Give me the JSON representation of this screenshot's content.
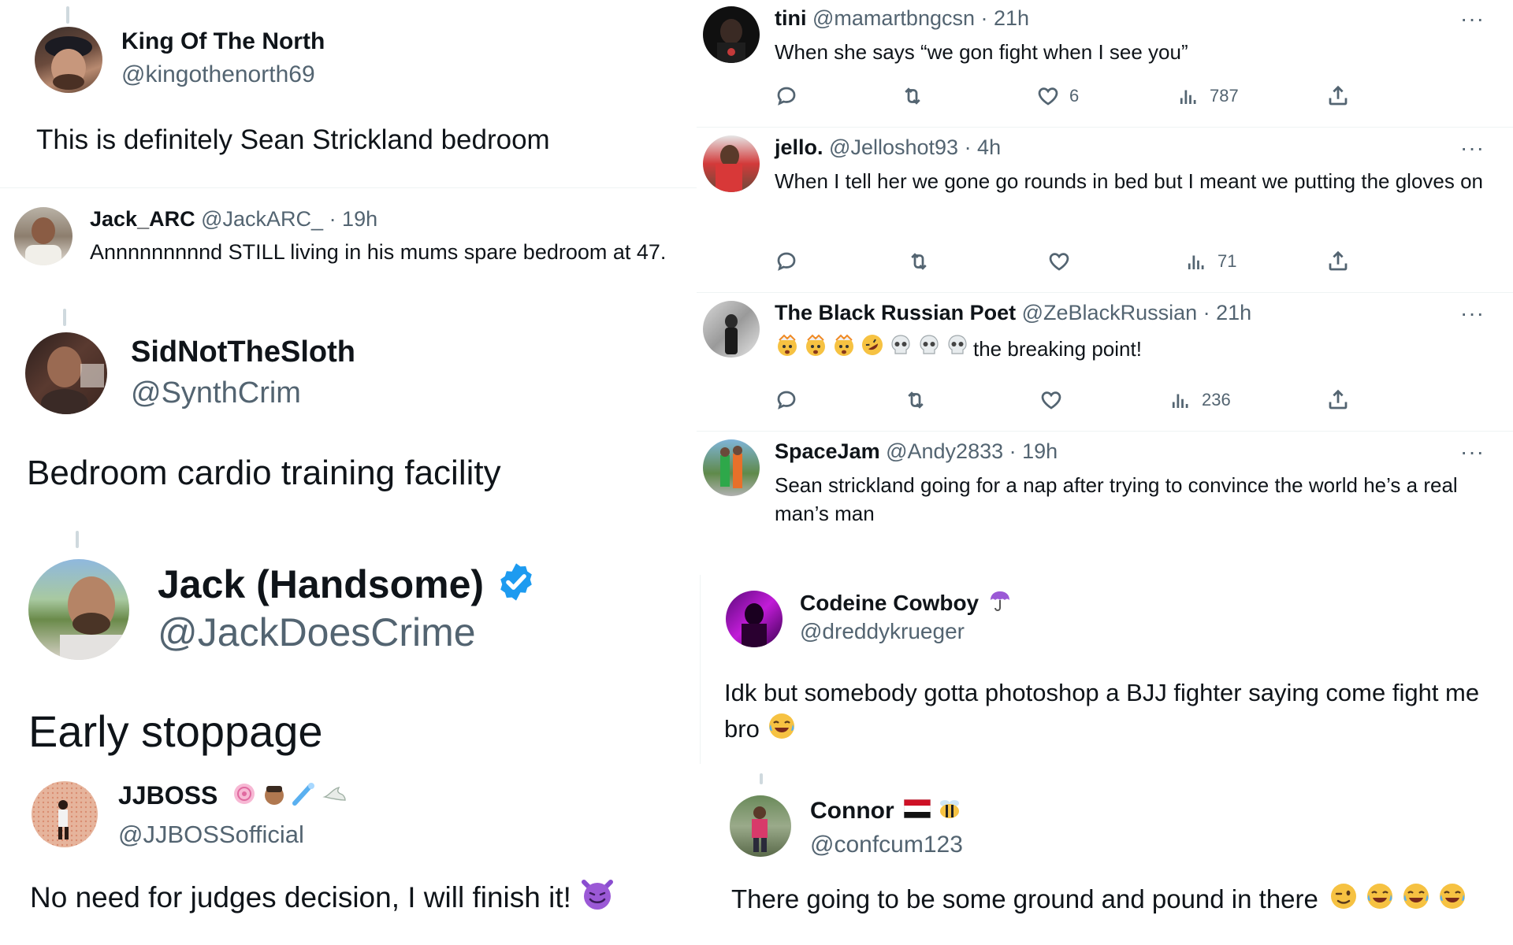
{
  "king": {
    "name": "King Of The North",
    "handle": "@kingothenorth69",
    "text": "This is definitely Sean Strickland bedroom"
  },
  "jackarc": {
    "name": "Jack_ARC",
    "handle": "@JackARC_",
    "time": "· 19h",
    "text": "Annnnnnnnnd STILL living in his mums spare bedroom at 47."
  },
  "sid": {
    "name": "SidNotTheSloth",
    "handle": "@SynthCrim",
    "text": "Bedroom cardio training facility"
  },
  "jackh": {
    "name": "Jack (Handsome)",
    "handle": "@JackDoesCrime",
    "text": "Early stoppage"
  },
  "jjboss": {
    "name": "JJBOSS",
    "handle": "@JJBOSSofficial",
    "text": "No need for judges decision, I will finish it!"
  },
  "tini": {
    "name": "tini",
    "handle": "@mamartbngcsn",
    "time": "· 21h",
    "text": "When she says “we gon fight when I see you”",
    "likes": "6",
    "views": "787"
  },
  "jello": {
    "name": "jello.",
    "handle": "@Jelloshot93",
    "time": "· 4h",
    "text": "When I tell her we gone go rounds in bed but I meant we putting the gloves on",
    "views": "71"
  },
  "poet": {
    "name": "The Black Russian Poet",
    "handle": "@ZeBlackRussian",
    "time": "· 21h",
    "text": "the breaking point!",
    "views": "236"
  },
  "spacejam": {
    "name": "SpaceJam",
    "handle": "@Andy2833",
    "time": "· 19h",
    "text": "Sean strickland going for a nap after trying to convince the world he’s a real man’s man"
  },
  "cowboy": {
    "name": "Codeine Cowboy",
    "handle": "@dreddykrueger",
    "text": "Idk but somebody gotta photoshop a BJJ fighter saying come fight me bro"
  },
  "connor": {
    "name": "Connor",
    "handle": "@confcum123",
    "text": "There going to be some ground and pound in there"
  },
  "more_label": "···",
  "colors": {
    "verified": "#1d9bf0",
    "secondary_text": "#536471",
    "divider": "#eff3f4"
  }
}
